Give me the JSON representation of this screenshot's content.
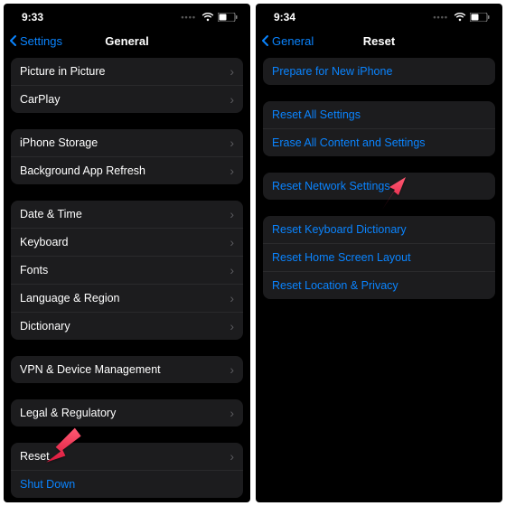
{
  "left": {
    "time": "9:33",
    "back_label": "Settings",
    "title": "General",
    "groups": [
      {
        "rows": [
          {
            "label": "Picture in Picture",
            "chevron": true
          },
          {
            "label": "CarPlay",
            "chevron": true
          }
        ]
      },
      {
        "rows": [
          {
            "label": "iPhone Storage",
            "chevron": true
          },
          {
            "label": "Background App Refresh",
            "chevron": true
          }
        ]
      },
      {
        "rows": [
          {
            "label": "Date & Time",
            "chevron": true
          },
          {
            "label": "Keyboard",
            "chevron": true
          },
          {
            "label": "Fonts",
            "chevron": true
          },
          {
            "label": "Language & Region",
            "chevron": true
          },
          {
            "label": "Dictionary",
            "chevron": true
          }
        ]
      },
      {
        "rows": [
          {
            "label": "VPN & Device Management",
            "chevron": true
          }
        ]
      },
      {
        "rows": [
          {
            "label": "Legal & Regulatory",
            "chevron": true
          }
        ]
      },
      {
        "rows": [
          {
            "label": "Reset",
            "chevron": true
          },
          {
            "label": "Shut Down",
            "chevron": false,
            "blue": true
          }
        ]
      }
    ]
  },
  "right": {
    "time": "9:34",
    "back_label": "General",
    "title": "Reset",
    "groups": [
      {
        "rows": [
          {
            "label": "Prepare for New iPhone",
            "blue": true
          }
        ]
      },
      {
        "rows": [
          {
            "label": "Reset All Settings",
            "blue": true
          },
          {
            "label": "Erase All Content and Settings",
            "blue": true
          }
        ]
      },
      {
        "rows": [
          {
            "label": "Reset Network Settings",
            "blue": true
          }
        ]
      },
      {
        "rows": [
          {
            "label": "Reset Keyboard Dictionary",
            "blue": true
          },
          {
            "label": "Reset Home Screen Layout",
            "blue": true
          },
          {
            "label": "Reset Location & Privacy",
            "blue": true
          }
        ]
      }
    ]
  },
  "colors": {
    "accent": "#0a84ff",
    "row_bg": "#1c1c1e",
    "arrow": "#ef2e4f"
  }
}
